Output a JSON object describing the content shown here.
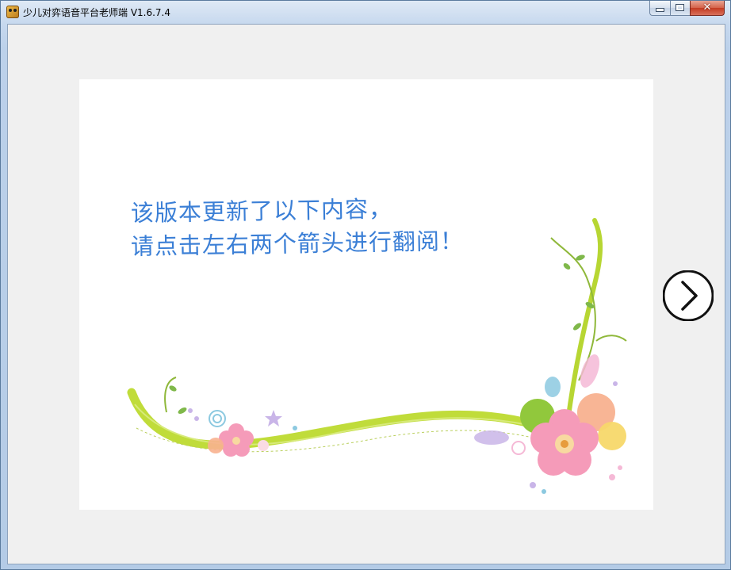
{
  "window": {
    "title": "少儿对弈语音平台老师端 V1.6.7.4",
    "close_glyph": "✕"
  },
  "content": {
    "line1": "该版本更新了以下内容，",
    "line2": "请点击左右两个箭头进行翻阅！"
  },
  "icons": {
    "app": "app-icon",
    "next": "chevron-right-circle-icon",
    "minimize": "minimize-icon",
    "maximize": "maximize-icon",
    "close": "close-icon"
  },
  "colors": {
    "message_text": "#3b7fd6",
    "vine": "#b7d633",
    "client_bg": "#f0f0f0",
    "card_bg": "#ffffff"
  }
}
